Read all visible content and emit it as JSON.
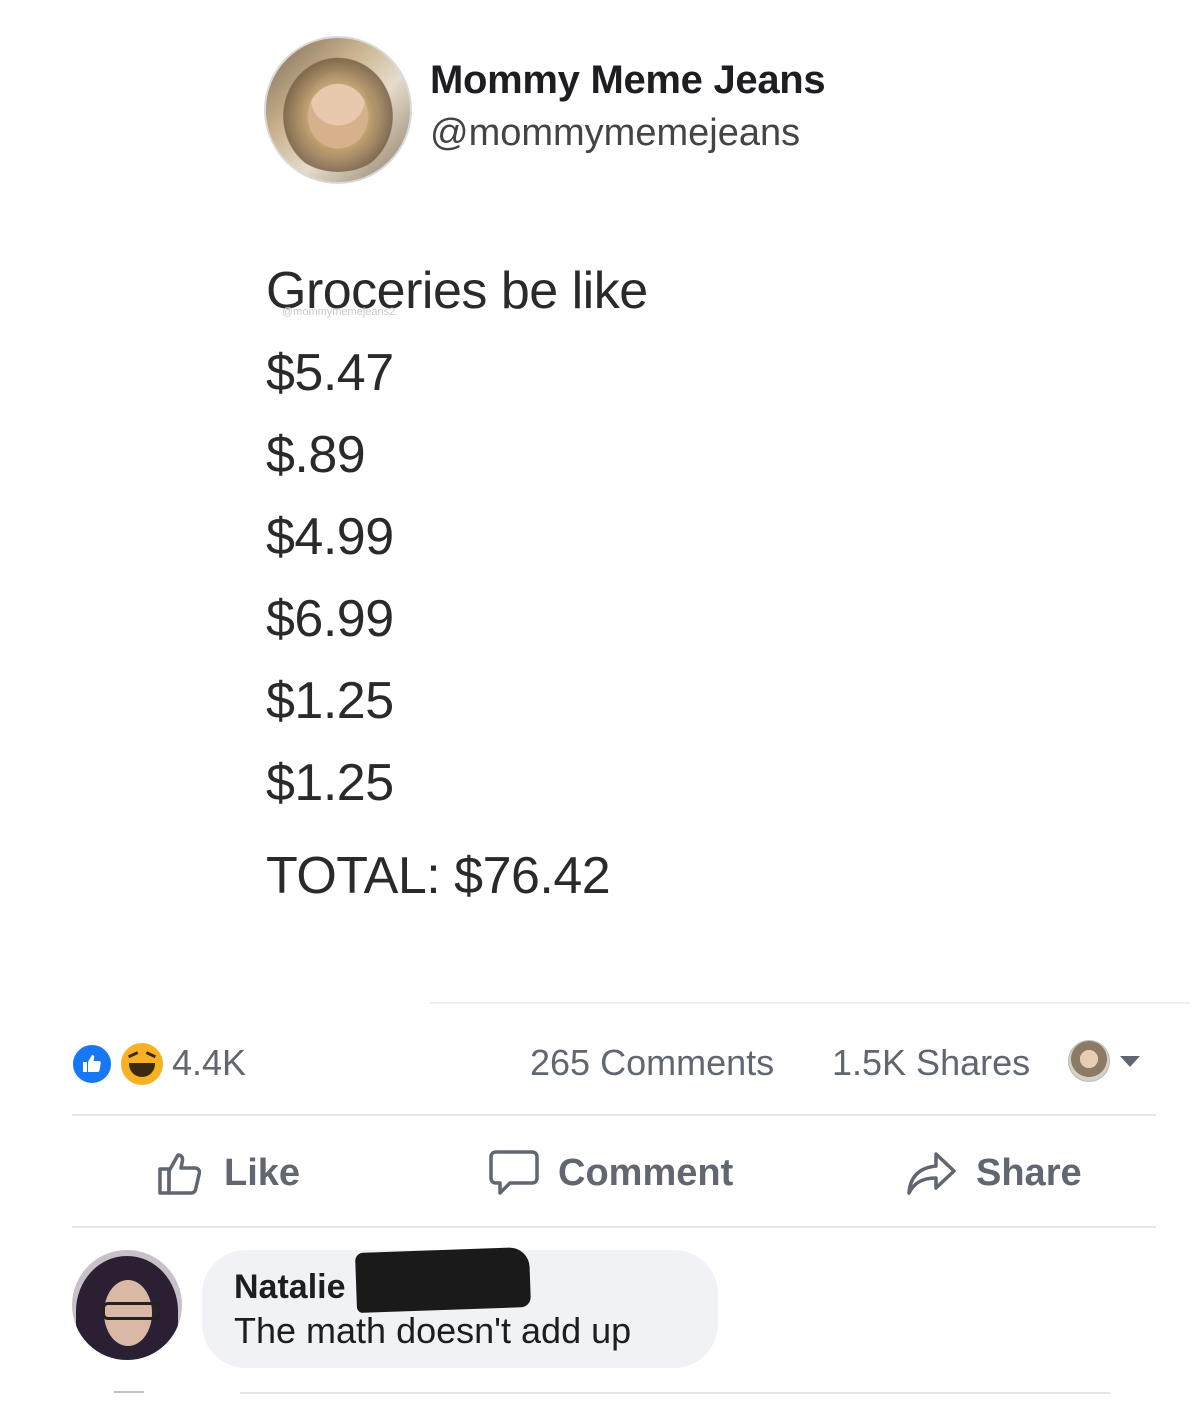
{
  "post": {
    "author": {
      "name": "Mommy Meme Jeans",
      "handle": "@mommymemejeans"
    },
    "watermark": "@mommymemejeans2",
    "lines": [
      "Groceries be like",
      "$5.47",
      "$.89",
      "$4.99",
      "$6.99",
      "$1.25",
      "$1.25"
    ],
    "total": "TOTAL: $76.42"
  },
  "stats": {
    "reactions": [
      "like-icon",
      "haha-icon"
    ],
    "reaction_count": "4.4K",
    "comments": "265 Comments",
    "shares": "1.5K Shares"
  },
  "actions": {
    "like_label": "Like",
    "comment_label": "Comment",
    "share_label": "Share"
  },
  "comment": {
    "author": "Natalie",
    "text": "The math doesn't add up"
  },
  "colors": {
    "like_blue": "#1877f2",
    "haha_yellow": "#f7b125",
    "meta_gray": "#606770",
    "bubble_bg": "#f0f2f5"
  }
}
